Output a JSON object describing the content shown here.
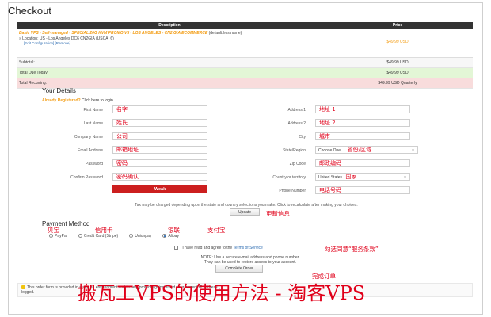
{
  "page": {
    "title": "Checkout"
  },
  "table": {
    "col_description": "Description",
    "col_price": "Price",
    "product": {
      "name": "Basic VPS - Self-managed - SPECIAL 20G KVM PROMO V5 - LOS ANGELES - CN2 GIA ECOMMERCE",
      "hostname": "(default.hostname)",
      "location": "» Location: US - Los Angeles DC6 CN2GIA (USCA_6)",
      "links": "[Edit Configuration] [Remove]",
      "price": "$49.99 USD"
    },
    "subtotal": {
      "label": "Subtotal:",
      "value": "$49.99 USD"
    },
    "total_due": {
      "label": "Total Due Today:",
      "value": "$49.99 USD"
    },
    "total_recurring": {
      "label": "Total Recurring:",
      "value": "$49.99 USD Quarterly"
    }
  },
  "details": {
    "title": "Your Details",
    "already_registered": "Already Registered?",
    "login_link": "Click here to login",
    "left_fields": [
      {
        "label": "First Name",
        "value": "名字"
      },
      {
        "label": "Last Name",
        "value": "姓氏"
      },
      {
        "label": "Company Name",
        "value": "公司"
      },
      {
        "label": "Email Address",
        "value": "邮箱地址"
      },
      {
        "label": "Password",
        "value": "密码"
      },
      {
        "label": "Confirm Password",
        "value": "密码确认"
      }
    ],
    "right_fields": [
      {
        "label": "Address 1",
        "value": "地址 1"
      },
      {
        "label": "Address 2",
        "value": "地址 2"
      },
      {
        "label": "City",
        "value": "城市"
      },
      {
        "label": "State/Region",
        "value": "Choose One...",
        "annotation": "省份/区域"
      },
      {
        "label": "Zip Code",
        "value": "邮政编码"
      },
      {
        "label": "Country or territory",
        "value": "United States",
        "annotation": "国家"
      },
      {
        "label": "Phone Number",
        "value": "电话号码"
      }
    ],
    "password_strength": "Weak"
  },
  "tax": {
    "note": "Tax may be charged depending upon the state and country selections you make. Click to recalculate after making your choices.",
    "update_button": "Update",
    "update_annotation": "更新信息"
  },
  "payment": {
    "title": "Payment Method",
    "annotations": [
      "贝宝",
      "信用卡",
      "银联",
      "支付宝"
    ],
    "options": [
      "PayPal",
      "Credit Card (Stripe)",
      "Unionpay",
      "Alipay"
    ],
    "selected": "Alipay"
  },
  "tos": {
    "text": "I have read and agree to the",
    "link": "Terms of Service",
    "annotation": "勾选同意“服务条款”"
  },
  "note": {
    "line1": "NOTE: Use a secure e-mail address and phone number.",
    "line2": "They can be used to restore access to your account."
  },
  "complete": {
    "button": "Complete Order",
    "annotation": "完成订单"
  },
  "bottom": {
    "text": "This order form is provided in a secure environment and to help protect against fraud your current IP address (",
    "text2": "logged."
  },
  "watermark": "搬瓦工VPS的使用方法 - 淘客VPS"
}
